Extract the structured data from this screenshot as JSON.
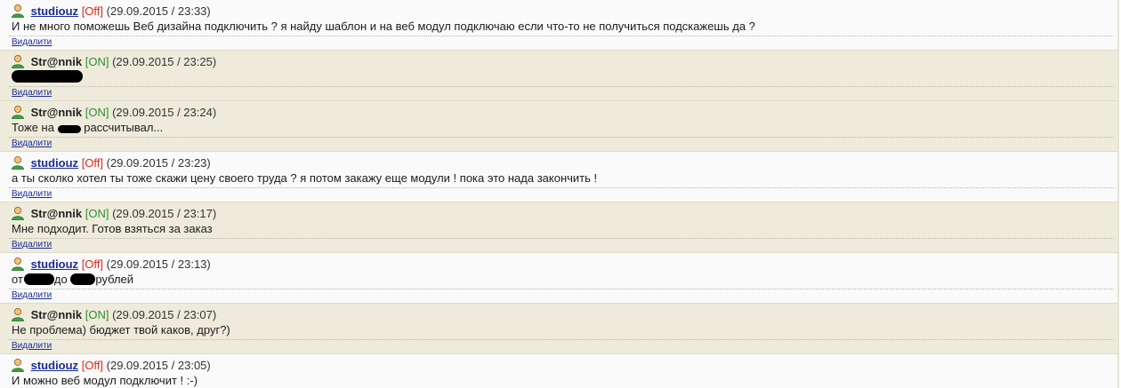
{
  "delete_label": "Видалити",
  "messages": [
    {
      "user": "studiouz",
      "status": "[Off]",
      "time": "(29.09.2015 / 23:33)",
      "text": "И не много поможешь Веб дизайна подключить ? я найду шаблон и на веб модул подключаю если что-то не получиться подскажешь да ?"
    },
    {
      "user": "Str@nnik",
      "status": "[ON]",
      "time": "(29.09.2015 / 23:25)",
      "text": ""
    },
    {
      "user": "Str@nnik",
      "status": "[ON]",
      "time": "(29.09.2015 / 23:24)",
      "text_a": "Тоже на",
      "text_b": "рассчитывал..."
    },
    {
      "user": "studiouz",
      "status": "[Off]",
      "time": "(29.09.2015 / 23:23)",
      "text": "а ты сколко хотел ты тоже скажи цену своего труда ? я потом закажу еще модули ! пока это нада закончить !"
    },
    {
      "user": "Str@nnik",
      "status": "[ON]",
      "time": "(29.09.2015 / 23:17)",
      "text": "Мне подходит. Готов взяться за заказ"
    },
    {
      "user": "studiouz",
      "status": "[Off]",
      "time": "(29.09.2015 / 23:13)",
      "text_a": "от",
      "text_b": "до",
      "text_c": "рублей"
    },
    {
      "user": "Str@nnik",
      "status": "[ON]",
      "time": "(29.09.2015 / 23:07)",
      "text": "Не проблема) бюджет твой каков, друг?)"
    },
    {
      "user": "studiouz",
      "status": "[Off]",
      "time": "(29.09.2015 / 23:05)",
      "text": "И можно веб модул подключит ! :-)"
    }
  ]
}
